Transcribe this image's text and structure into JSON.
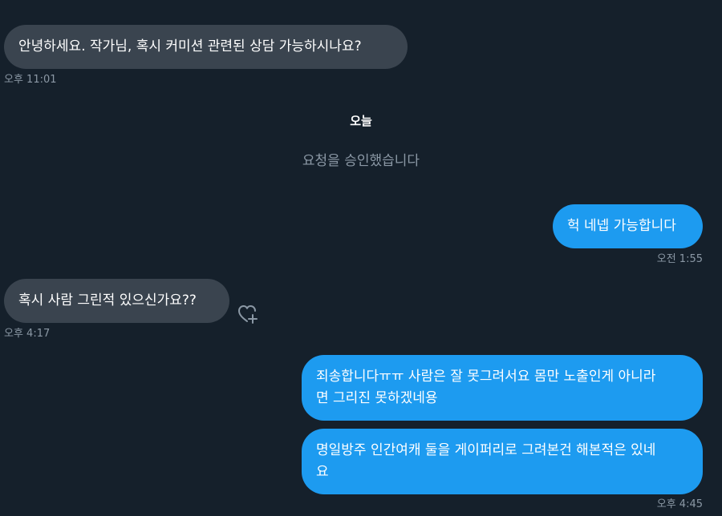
{
  "conversation": {
    "messages": [
      {
        "direction": "received",
        "text": "안녕하세요. 작가님, 혹시 커미션 관련된 상담 가능하시나요?",
        "time": "오후 11:01"
      },
      {
        "direction": "sent",
        "text": "헉 네넵 가능합니다",
        "time": "오전 1:55"
      },
      {
        "direction": "received",
        "text": "혹시 사람 그린적 있으신가요??",
        "time": "오후 4:17"
      },
      {
        "direction": "sent",
        "text": "죄송합니다ㅠㅠ 사람은 잘 못그려서요 몸만 노출인게 아니라\n면 그리진 못하겠네용",
        "time": ""
      },
      {
        "direction": "sent",
        "text": "명일방주 인간여캐 둘을 게이퍼리로 그려본건 해본적은 있네\n요",
        "time": "오후 4:45"
      }
    ],
    "day_divider": "오늘",
    "system_note": "요청을 승인했습니다"
  },
  "icons": {
    "react": "heart-plus-icon"
  },
  "colors": {
    "background": "#15202b",
    "received_bubble": "#3a444f",
    "sent_bubble": "#1d9bf0",
    "timestamp": "#8b98a5"
  }
}
